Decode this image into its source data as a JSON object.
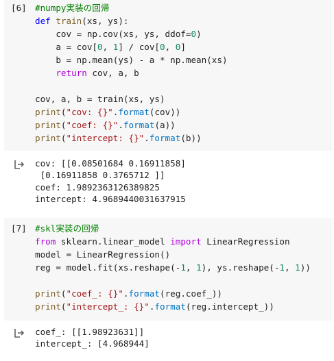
{
  "cells": [
    {
      "prompt": "[6]",
      "code_lines": [
        [
          {
            "t": "#numpy実装の回帰",
            "c": "cm"
          }
        ],
        [
          {
            "t": "def ",
            "c": "def"
          },
          {
            "t": "train",
            "c": "fn"
          },
          {
            "t": "(xs, ys):",
            "c": ""
          }
        ],
        [
          {
            "t": "    cov = np.cov(xs, ys, ddof=",
            "c": ""
          },
          {
            "t": "0",
            "c": "num"
          },
          {
            "t": ")",
            "c": ""
          }
        ],
        [
          {
            "t": "    a = cov[",
            "c": ""
          },
          {
            "t": "0",
            "c": "num"
          },
          {
            "t": ", ",
            "c": ""
          },
          {
            "t": "1",
            "c": "num"
          },
          {
            "t": "] / cov[",
            "c": ""
          },
          {
            "t": "0",
            "c": "num"
          },
          {
            "t": ", ",
            "c": ""
          },
          {
            "t": "0",
            "c": "num"
          },
          {
            "t": "]",
            "c": ""
          }
        ],
        [
          {
            "t": "    b = np.mean(ys) - a * np.mean(xs)",
            "c": ""
          }
        ],
        [
          {
            "t": "    ",
            "c": ""
          },
          {
            "t": "return",
            "c": "kw"
          },
          {
            "t": " cov, a, b",
            "c": ""
          }
        ],
        [
          {
            "t": "",
            "c": ""
          }
        ],
        [
          {
            "t": "cov, a, b = train(xs, ys)",
            "c": ""
          }
        ],
        [
          {
            "t": "print",
            "c": "fn"
          },
          {
            "t": "(",
            "c": ""
          },
          {
            "t": "\"cov: {}\"",
            "c": "str"
          },
          {
            "t": ".",
            "c": ""
          },
          {
            "t": "format",
            "c": "attr"
          },
          {
            "t": "(cov))",
            "c": ""
          }
        ],
        [
          {
            "t": "print",
            "c": "fn"
          },
          {
            "t": "(",
            "c": ""
          },
          {
            "t": "\"coef: {}\"",
            "c": "str"
          },
          {
            "t": ".",
            "c": ""
          },
          {
            "t": "format",
            "c": "attr"
          },
          {
            "t": "(a))",
            "c": ""
          }
        ],
        [
          {
            "t": "print",
            "c": "fn"
          },
          {
            "t": "(",
            "c": ""
          },
          {
            "t": "\"intercept: {}\"",
            "c": "str"
          },
          {
            "t": ".",
            "c": ""
          },
          {
            "t": "format",
            "c": "attr"
          },
          {
            "t": "(b))",
            "c": ""
          }
        ]
      ],
      "output_lines": [
        "cov: [[0.08501684 0.16911858]",
        " [0.16911858 0.3765712 ]]",
        "coef: 1.9892363126389825",
        "intercept: 4.9689440031637915"
      ]
    },
    {
      "prompt": "[7]",
      "code_lines": [
        [
          {
            "t": "#skl実装の回帰",
            "c": "cm"
          }
        ],
        [
          {
            "t": "from",
            "c": "kw"
          },
          {
            "t": " sklearn.linear_model ",
            "c": ""
          },
          {
            "t": "import",
            "c": "kw"
          },
          {
            "t": " LinearRegression",
            "c": ""
          }
        ],
        [
          {
            "t": "model = LinearRegression()",
            "c": ""
          }
        ],
        [
          {
            "t": "reg = model.fit(xs.reshape(-",
            "c": ""
          },
          {
            "t": "1",
            "c": "num"
          },
          {
            "t": ", ",
            "c": ""
          },
          {
            "t": "1",
            "c": "num"
          },
          {
            "t": "), ys.reshape(-",
            "c": ""
          },
          {
            "t": "1",
            "c": "num"
          },
          {
            "t": ", ",
            "c": ""
          },
          {
            "t": "1",
            "c": "num"
          },
          {
            "t": "))",
            "c": ""
          }
        ],
        [
          {
            "t": "",
            "c": ""
          }
        ],
        [
          {
            "t": "print",
            "c": "fn"
          },
          {
            "t": "(",
            "c": ""
          },
          {
            "t": "\"coef_: {}\"",
            "c": "str"
          },
          {
            "t": ".",
            "c": ""
          },
          {
            "t": "format",
            "c": "attr"
          },
          {
            "t": "(reg.coef_))",
            "c": ""
          }
        ],
        [
          {
            "t": "print",
            "c": "fn"
          },
          {
            "t": "(",
            "c": ""
          },
          {
            "t": "\"intercept_: {}\"",
            "c": "str"
          },
          {
            "t": ".",
            "c": ""
          },
          {
            "t": "format",
            "c": "attr"
          },
          {
            "t": "(reg.intercept_))",
            "c": ""
          }
        ]
      ],
      "output_lines": [
        "coef_: [[1.98923631]]",
        "intercept_: [4.968944]"
      ]
    }
  ],
  "icons": {
    "output": "output-arrow-icon"
  }
}
